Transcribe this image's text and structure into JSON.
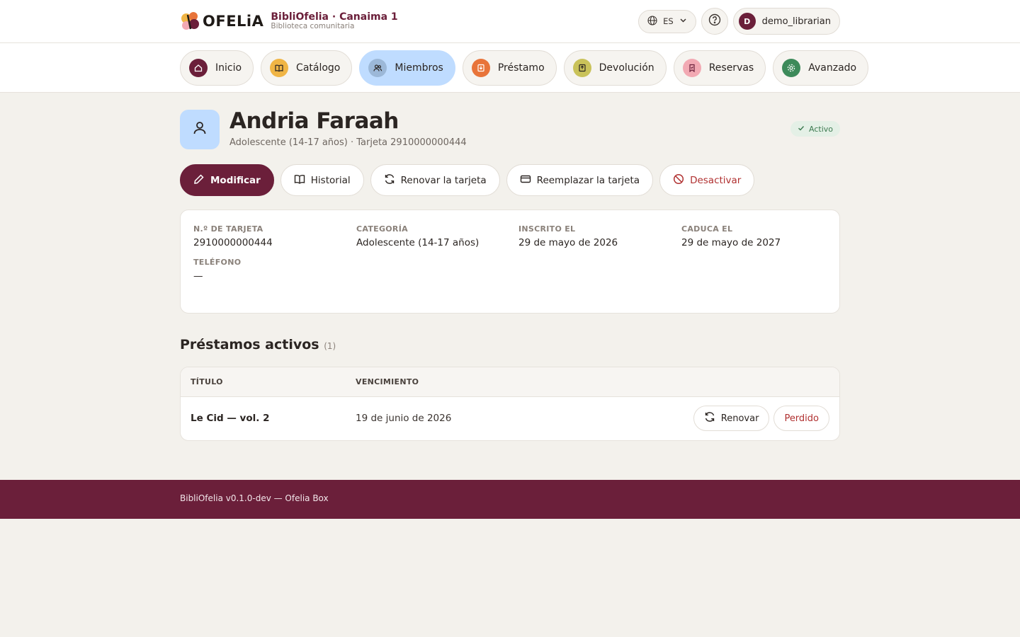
{
  "brand": {
    "logo_text": "OFELiA",
    "title": "BibliOfelia · Canaima 1",
    "subtitle": "Biblioteca comunitaria"
  },
  "header": {
    "language": "ES",
    "user_initial": "D",
    "username": "demo_librarian"
  },
  "nav": {
    "tabs": [
      {
        "label": "Inicio",
        "icon": "home-icon",
        "color": "#6b1f3a"
      },
      {
        "label": "Catálogo",
        "icon": "book-open-icon",
        "color": "#f0b545"
      },
      {
        "label": "Miembros",
        "icon": "users-icon",
        "color": "#9cb8d8",
        "active": true
      },
      {
        "label": "Préstamo",
        "icon": "checkout-icon",
        "color": "#e8743a"
      },
      {
        "label": "Devolución",
        "icon": "return-icon",
        "color": "#c9c25a"
      },
      {
        "label": "Reservas",
        "icon": "bookmark-icon",
        "color": "#f2a9b3"
      },
      {
        "label": "Avanzado",
        "icon": "gear-icon",
        "color": "#3d8a5a"
      }
    ]
  },
  "member": {
    "name": "Andria Faraah",
    "subtitle": "Adolescente (14-17 años) · Tarjeta 2910000000444",
    "status": "Activo"
  },
  "actions": {
    "edit": "Modificar",
    "history": "Historial",
    "renew_card": "Renovar la tarjeta",
    "replace_card": "Reemplazar la tarjeta",
    "deactivate": "Desactivar"
  },
  "details": {
    "card_label": "N.º DE TARJETA",
    "card_value": "2910000000444",
    "category_label": "CATEGORÍA",
    "category_value": "Adolescente (14-17 años)",
    "enrolled_label": "INSCRITO EL",
    "enrolled_value": "29 de mayo de 2026",
    "expires_label": "CADUCA EL",
    "expires_value": "29 de mayo de 2027",
    "phone_label": "TELÉFONO",
    "phone_value": "—"
  },
  "loans": {
    "title": "Préstamos activos",
    "count": "(1)",
    "col_title": "TÍTULO",
    "col_due": "VENCIMIENTO",
    "rows": [
      {
        "title": "Le Cid — vol. 2",
        "due": "19 de junio de 2026",
        "renew": "Renovar",
        "lost": "Perdido"
      }
    ]
  },
  "footer": {
    "text": "BibliOfelia v0.1.0-dev — Ofelia Box"
  }
}
